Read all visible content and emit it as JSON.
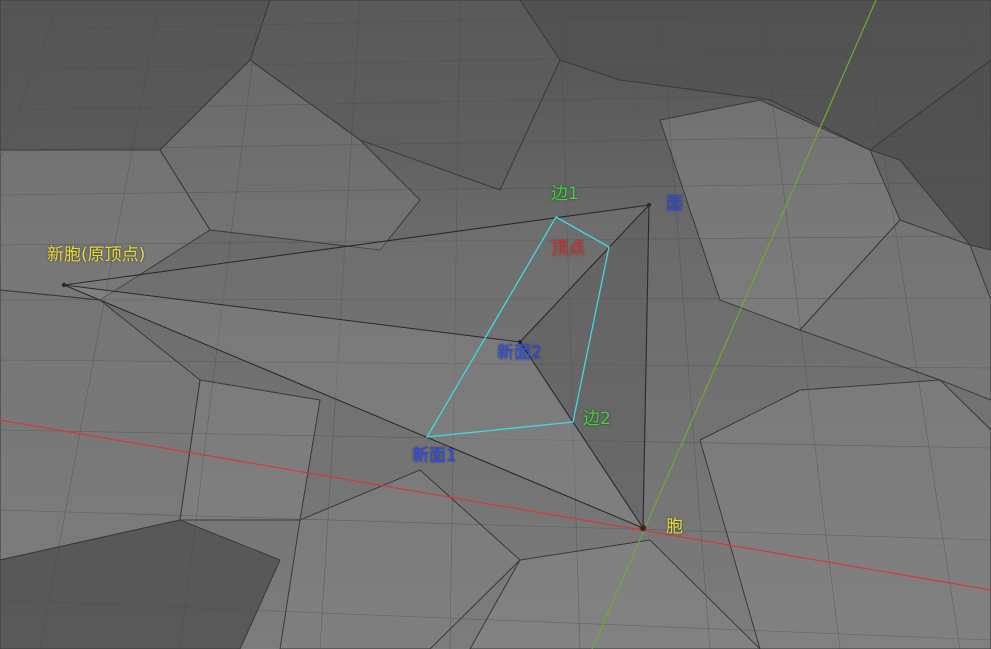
{
  "labels": {
    "new_cell": "新胞(原顶点)",
    "edge1": "边1",
    "face": "面",
    "vertex": "顶点",
    "new_face2": "新面2",
    "edge2": "边2",
    "new_face1": "新面1",
    "cell": "胞"
  },
  "colors": {
    "new_cell": "#e8d83a",
    "cell": "#e8d83a",
    "edge": "#3ad83a",
    "face": "#2a4cf0",
    "vertex": "#e83030",
    "section": "#40d8e0",
    "axis_x": "#d83838",
    "axis_y": "#70a830",
    "background": "#6b6b6b"
  }
}
